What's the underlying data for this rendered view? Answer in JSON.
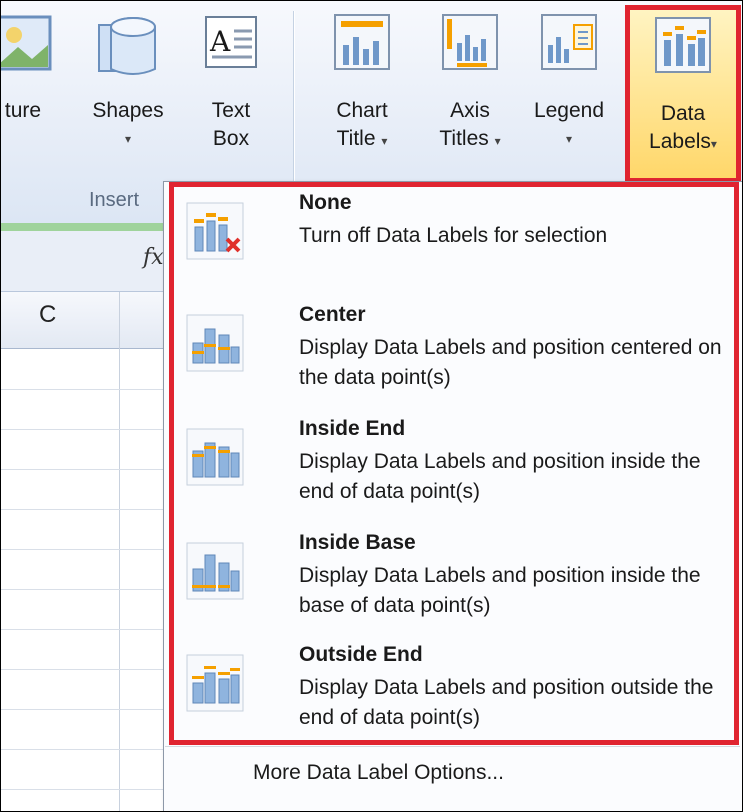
{
  "ribbon": {
    "buttons": {
      "picture": "ture",
      "shapes": "Shapes",
      "text_box_line1": "Text",
      "text_box_line2": "Box",
      "chart_title_line1": "Chart",
      "chart_title_line2": "Title",
      "axis_titles_line1": "Axis",
      "axis_titles_line2": "Titles",
      "legend": "Legend",
      "data_labels_line1": "Data",
      "data_labels_line2": "Labels"
    },
    "arrow": "▾",
    "group_label": "Insert"
  },
  "sheet": {
    "fx": "fx",
    "column_c": "C"
  },
  "menu": {
    "items": [
      {
        "title": "None",
        "desc": "Turn off Data Labels for selection"
      },
      {
        "title": "Center",
        "desc": "Display Data Labels and position centered on the data point(s)"
      },
      {
        "title": "Inside End",
        "desc": "Display Data Labels and position inside the end of data point(s)"
      },
      {
        "title": "Inside Base",
        "desc": "Display Data Labels and position inside the base of data point(s)"
      },
      {
        "title": "Outside End",
        "desc": "Display Data Labels and position outside the end of data point(s)"
      }
    ],
    "more_options": "More Data Label Options..."
  },
  "colors": {
    "highlight_border": "#e02430",
    "accent_orange": "#f5a000",
    "bar_blue": "#8fb4de"
  }
}
